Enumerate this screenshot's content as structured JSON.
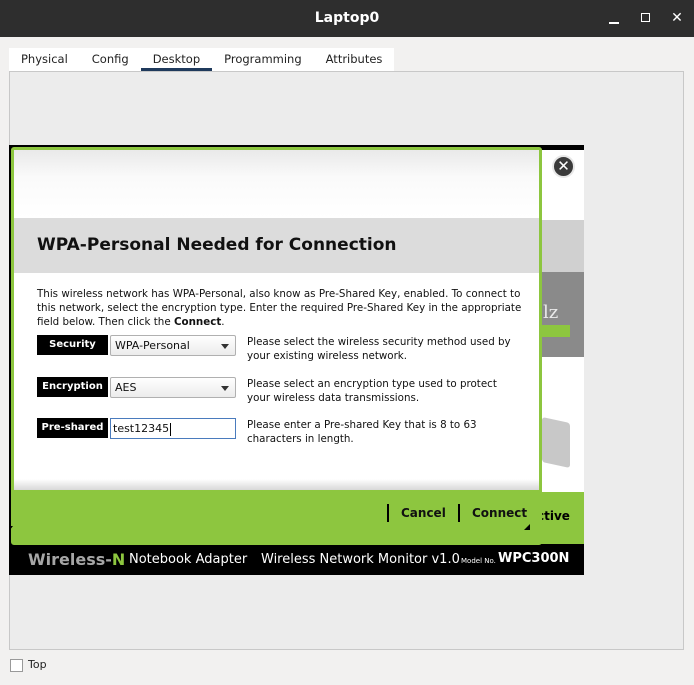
{
  "window": {
    "title": "Laptop0"
  },
  "tabs": [
    {
      "label": "Physical"
    },
    {
      "label": "Config"
    },
    {
      "label": "Desktop",
      "active": true
    },
    {
      "label": "Programming"
    },
    {
      "label": "Attributes"
    }
  ],
  "background_app": {
    "partial_text_right": "lz",
    "status_partial": "ctive"
  },
  "dialog": {
    "heading": "WPA-Personal Needed for Connection",
    "intro_pre": "This wireless network has WPA-Personal, also know as Pre-Shared Key, enabled. To connect to this network, select the encryption type. Enter the required Pre-Shared Key in the appropriate field below. Then click the ",
    "intro_bold": "Connect",
    "intro_post": ".",
    "security": {
      "label": "Security",
      "value": "WPA-Personal",
      "description": "Please select the wireless security method used by your existing wireless network."
    },
    "encryption": {
      "label": "Encryption",
      "value": "AES",
      "description": "Please select an encryption type used to protect your wireless data transmissions."
    },
    "psk": {
      "label": "Pre-shared Key",
      "value": "test12345",
      "description": "Please enter a Pre-shared Key that is 8 to 63 characters in length."
    },
    "cancel_label": "Cancel",
    "connect_label": "Connect"
  },
  "footer": {
    "brand_a": "Wireless-",
    "brand_b": "N",
    "product": "Notebook Adapter",
    "monitor": "Wireless Network Monitor  v1.0",
    "model_prefix": "Model No.",
    "model": "WPC300N"
  },
  "bottom": {
    "top_label": "Top",
    "top_checked": false
  },
  "colors": {
    "accent_green": "#8dc63f",
    "titlebar": "#2e2e2e"
  }
}
